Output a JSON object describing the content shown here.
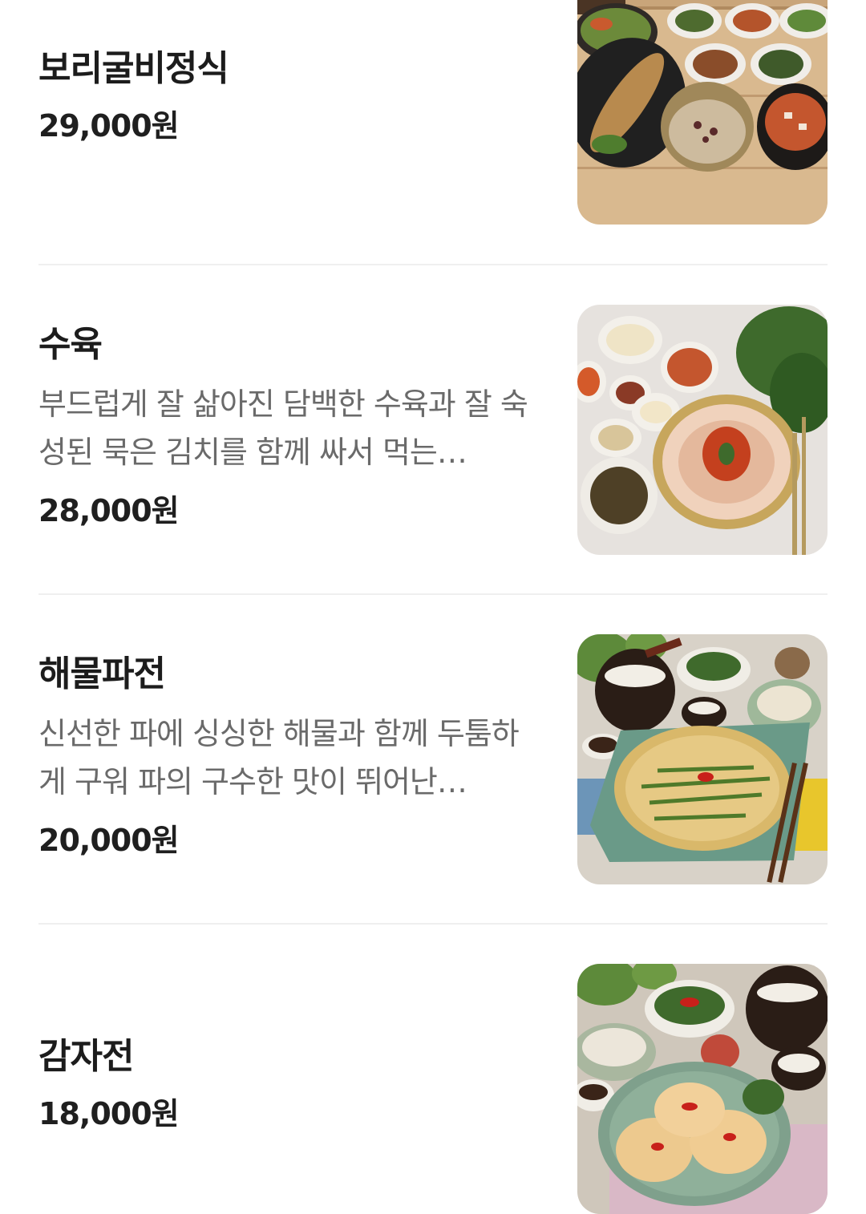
{
  "menu": {
    "items": [
      {
        "name": "보리굴비정식",
        "description": "",
        "price": "29,000원",
        "photo_icon": "barley-croaker-set-photo"
      },
      {
        "name": "수육",
        "description": "부드럽게 잘 삶아진 담백한 수육과 잘 숙성된 묵은 김치를 함께 싸서 먹는…",
        "price": "28,000원",
        "photo_icon": "boiled-pork-photo"
      },
      {
        "name": "해물파전",
        "description": "신선한 파에 싱싱한 해물과 함께 두툼하게 구워 파의 구수한 맛이 뛰어난…",
        "price": "20,000원",
        "photo_icon": "seafood-pancake-photo"
      },
      {
        "name": "감자전",
        "description": "",
        "price": "18,000원",
        "photo_icon": "potato-pancake-photo"
      }
    ]
  }
}
